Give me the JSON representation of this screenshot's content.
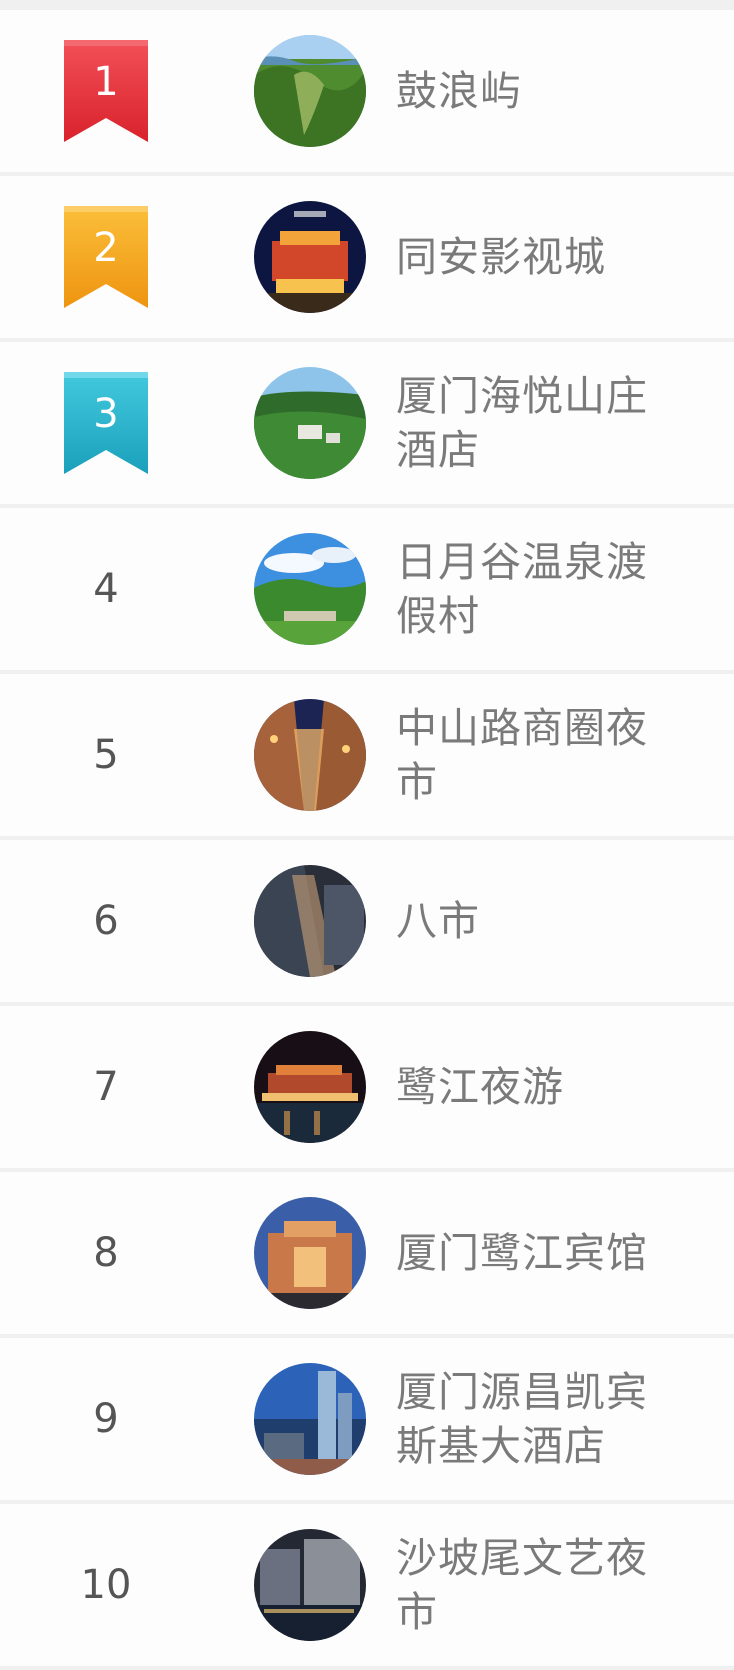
{
  "ranking": {
    "items": [
      {
        "rank": "1",
        "name": "鼓浪屿",
        "badge": "ribbon",
        "badge_color": "#e8313b",
        "badge_shade": "#c51f29",
        "thumb_theme": "island-aerial"
      },
      {
        "rank": "2",
        "name": "同安影视城",
        "badge": "ribbon",
        "badge_color": "#f6a41c",
        "badge_shade": "#e08810",
        "thumb_theme": "palace-night"
      },
      {
        "rank": "3",
        "name": "厦门海悦山庄酒店",
        "badge": "ribbon",
        "badge_color": "#29b6cf",
        "badge_shade": "#1795ad",
        "thumb_theme": "forest-resort"
      },
      {
        "rank": "4",
        "name": "日月谷温泉渡假村",
        "badge": "plain",
        "thumb_theme": "garden-sky"
      },
      {
        "rank": "5",
        "name": "中山路商圈夜市",
        "badge": "plain",
        "thumb_theme": "street-night"
      },
      {
        "rank": "6",
        "name": "八市",
        "badge": "plain",
        "thumb_theme": "market-aerial"
      },
      {
        "rank": "7",
        "name": "鹭江夜游",
        "badge": "plain",
        "thumb_theme": "boat-night"
      },
      {
        "rank": "8",
        "name": "厦门鹭江宾馆",
        "badge": "plain",
        "thumb_theme": "hotel-dusk"
      },
      {
        "rank": "9",
        "name": "厦门源昌凯宾斯基大酒店",
        "badge": "plain",
        "thumb_theme": "skyline-tower"
      },
      {
        "rank": "10",
        "name": "沙坡尾文艺夜市",
        "badge": "plain",
        "thumb_theme": "harbor-night"
      }
    ]
  }
}
